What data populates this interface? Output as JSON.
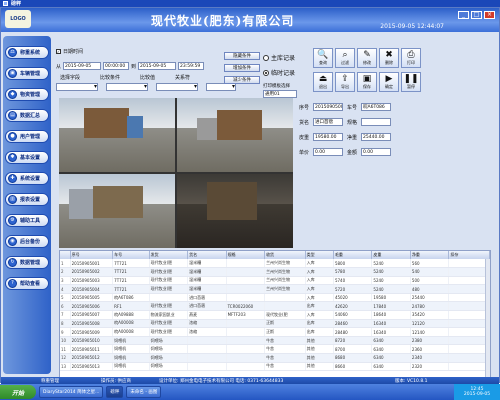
{
  "window": {
    "title": "磅秤"
  },
  "banner": {
    "logo_text": "LOGO",
    "company": "现代牧业(肥东)有限公司",
    "clock": "2015-09-05 12:44:07",
    "win_buttons": [
      "_",
      "□",
      "×"
    ]
  },
  "sidebar": {
    "items": [
      {
        "icon": "scale-icon",
        "glyph": "⚖",
        "label": "称重系统"
      },
      {
        "icon": "truck-icon",
        "glyph": "▣",
        "label": "车辆管理"
      },
      {
        "icon": "box-icon",
        "glyph": "◆",
        "label": "物资管理"
      },
      {
        "icon": "chart-icon",
        "glyph": "▤",
        "label": "数据汇总"
      },
      {
        "icon": "user-icon",
        "glyph": "●",
        "label": "用户管理"
      },
      {
        "icon": "settings-icon",
        "glyph": "✱",
        "label": "基本设置"
      },
      {
        "icon": "wrench-icon",
        "glyph": "✚",
        "label": "系统设置"
      },
      {
        "icon": "report-icon",
        "glyph": "▥",
        "label": "报表设置"
      },
      {
        "icon": "tool-icon",
        "glyph": "⚙",
        "label": "辅助工具"
      },
      {
        "icon": "backup-icon",
        "glyph": "◉",
        "label": "后台备份"
      },
      {
        "icon": "sync-icon",
        "glyph": "↻",
        "label": "数据管理"
      },
      {
        "icon": "help-icon",
        "glyph": "?",
        "label": "帮助查看"
      }
    ]
  },
  "filters": {
    "daterange_label": "日期时间",
    "from_label": "从",
    "to_label": "到",
    "date_from": "2015-09-05",
    "time_from": "00:00:00",
    "date_to": "2015-09-05",
    "time_to": "23:59:59",
    "col1": "选择字段",
    "col2": "比较条件",
    "col3": "比较值",
    "col4": "关系符"
  },
  "mid_buttons": {
    "b1": "隐藏条件",
    "b2": "增加条件",
    "b3": "减少条件"
  },
  "radio": {
    "r1": "主库记录",
    "r2": "临时记录",
    "print_label": "打印模板选择",
    "print_value": "通用01"
  },
  "toolbar": [
    {
      "icon": "search-icon",
      "glyph": "🔍",
      "label": "查询"
    },
    {
      "icon": "zoom-icon",
      "glyph": "⌕",
      "label": "过滤"
    },
    {
      "icon": "edit-icon",
      "glyph": "✎",
      "label": "修改"
    },
    {
      "icon": "delete-icon",
      "glyph": "✖",
      "label": "删除"
    },
    {
      "icon": "print-icon",
      "glyph": "⎙",
      "label": "打印"
    },
    {
      "icon": "exit-icon",
      "glyph": "⏏",
      "label": "退出"
    },
    {
      "icon": "export-icon",
      "glyph": "⇪",
      "label": "导出"
    },
    {
      "icon": "save-icon",
      "glyph": "▣",
      "label": "保存"
    },
    {
      "icon": "play-icon",
      "glyph": "▶",
      "label": "确定"
    },
    {
      "icon": "pause-icon",
      "glyph": "❚❚",
      "label": "暂停"
    }
  ],
  "photos": [
    "",
    "",
    "",
    ""
  ],
  "form": {
    "l1": "序号",
    "v1": "20150905002",
    "l2": "车号",
    "v2": "皖A6T086",
    "l3": "货名",
    "v3": "进口苜蓿",
    "l4": "规格",
    "v4": "",
    "l5": "皮重",
    "v5": "19580.00",
    "l6": "毛重",
    "v6": "",
    "l7": "净重",
    "v7": "25440.00",
    "l8": "单价",
    "v8": "0.00",
    "l9": "金额",
    "v9": "0.00"
  },
  "table": {
    "headers": [
      "",
      "序号",
      "车号",
      "发货",
      "货名",
      "规格",
      "收货",
      "类型",
      "毛重",
      "皮重",
      "净重",
      "扣杂"
    ],
    "rows": [
      [
        "1",
        "20150905001",
        "7T721",
        "现代牧业(肥",
        "湿米糟",
        "",
        "兰州兴尚生物",
        "入库",
        "5800",
        "5240",
        "560",
        ""
      ],
      [
        "2",
        "20150905002",
        "7T721",
        "现代牧业(肥",
        "湿米糟",
        "",
        "兰州兴尚生物",
        "入库",
        "5780",
        "5240",
        "540",
        ""
      ],
      [
        "3",
        "20150905003",
        "7T721",
        "现代牧业(肥",
        "湿米糟",
        "",
        "兰州兴尚生物",
        "入库",
        "5740",
        "5240",
        "500",
        ""
      ],
      [
        "4",
        "20150905004",
        "7T721",
        "现代牧业(肥",
        "湿米糟",
        "",
        "兰州兴尚生物",
        "入库",
        "5720",
        "5240",
        "480",
        ""
      ],
      [
        "5",
        "20150905005",
        "皖A6T086",
        "",
        "进口苜蓿",
        "",
        "",
        "入库",
        "45020",
        "19580",
        "25440",
        ""
      ],
      [
        "6",
        "20150905006",
        "RF1",
        "现代牧业(肥",
        "进口苜蓿",
        "TCR0022060",
        "",
        "出库",
        "42620",
        "17840",
        "24780",
        ""
      ],
      [
        "7",
        "20150905007",
        "皖A09888",
        "物流家园凯业",
        "燕麦",
        "MFTF203",
        "现代牧业(肥",
        "入库",
        "54060",
        "18640",
        "35420",
        ""
      ],
      [
        "8",
        "20150905008",
        "皖A00008",
        "现代牧业(肥",
        "浓缩",
        "",
        "正斯",
        "出库",
        "28460",
        "16340",
        "12120",
        ""
      ],
      [
        "9",
        "20150905009",
        "皖A00008",
        "现代牧业(肥",
        "浓缩",
        "",
        "正斯",
        "出库",
        "28480",
        "16340",
        "12140",
        ""
      ],
      [
        "10",
        "20150905010",
        "饲喂机",
        "饲喂场",
        "",
        "",
        "牛舍",
        "其他",
        "8720",
        "6340",
        "2380",
        ""
      ],
      [
        "11",
        "20150905011",
        "饲喂机",
        "饲喂场",
        "",
        "",
        "牛舍",
        "其他",
        "8700",
        "6340",
        "2360",
        ""
      ],
      [
        "12",
        "20150905012",
        "饲喂机",
        "饲喂场",
        "",
        "",
        "牛舍",
        "其他",
        "8680",
        "6340",
        "2340",
        ""
      ],
      [
        "13",
        "20150905013",
        "饲喂机",
        "饲喂场",
        "",
        "",
        "牛舍",
        "其他",
        "8660",
        "6340",
        "2320",
        ""
      ]
    ]
  },
  "status": {
    "s1": "称重管理",
    "s2": "操作员: 供应商",
    "s3": "设计单位: 郑州金电电子技术有限公司 电话: 0371-63644833",
    "s4": "版本: VC10.8.1"
  },
  "taskbar": {
    "start": "开始",
    "items": [
      "DiaryStar2014 简体之星...",
      "磅秤",
      "未命名 - 画图"
    ],
    "tray_time": "12:45",
    "tray_date": "2015-09-05"
  }
}
